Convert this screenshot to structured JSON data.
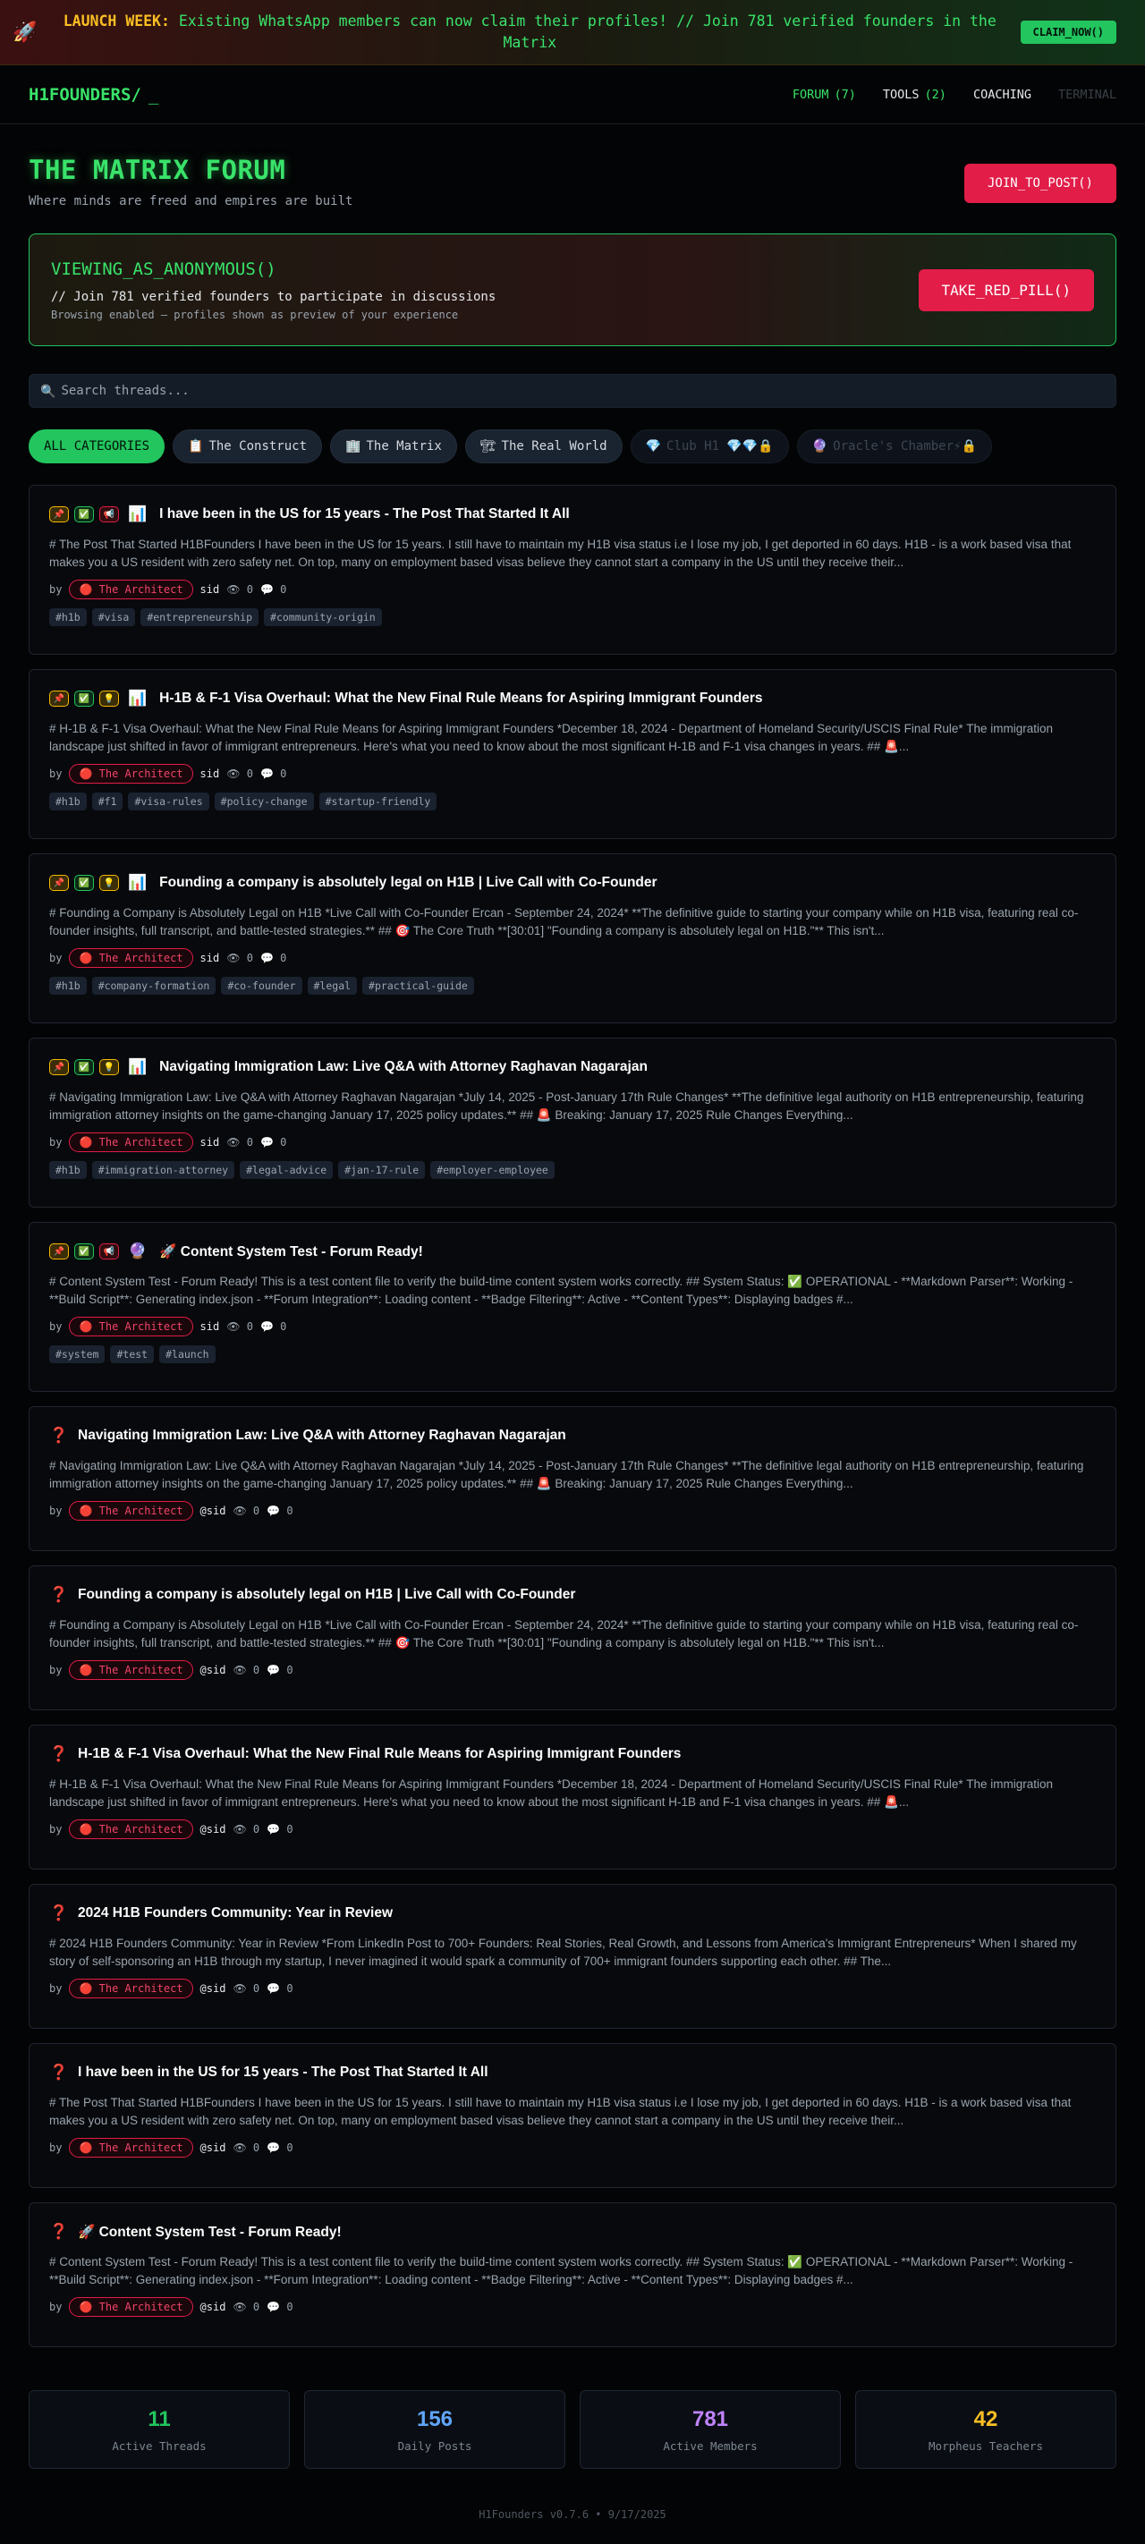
{
  "banner": {
    "icon": "rocket-icon",
    "lead": "LAUNCH WEEK:",
    "message": "Existing WhatsApp members can now claim their profiles! // Join 781 verified founders in the Matrix",
    "cta": "CLAIM_NOW()"
  },
  "nav": {
    "logo": "H1FOUNDERS/",
    "cursor": "_",
    "links": [
      {
        "label": "FORUM",
        "count": "(7)"
      },
      {
        "label": "TOOLS",
        "count": "(2)"
      },
      {
        "label": "COACHING",
        "count": ""
      },
      {
        "label": "TERMINAL",
        "count": ""
      }
    ]
  },
  "header": {
    "title": "THE MATRIX FORUM",
    "subtitle": "Where minds are freed and empires are built",
    "join": "JOIN_TO_POST()"
  },
  "anon": {
    "title": "VIEWING_AS_ANONYMOUS()",
    "line1": "// Join 781 verified founders to participate in discussions",
    "line2": "Browsing enabled — profiles shown as preview of your experience",
    "cta": "TAKE_RED_PILL()"
  },
  "search": {
    "placeholder": "Search threads..."
  },
  "categories": [
    {
      "label": "ALL CATEGORIES",
      "icon": ""
    },
    {
      "label": "The Construct",
      "icon": "📋"
    },
    {
      "label": "The Matrix",
      "icon": "🏢"
    },
    {
      "label": "The Real World",
      "icon": "🏗"
    },
    {
      "label": "Club H1 💎💎🔒",
      "icon": "💎"
    },
    {
      "label": "Oracle's Chamber⚡🔒",
      "icon": "🔮"
    }
  ],
  "threads": [
    {
      "title": "I have been in the US for 15 years - The Post That Started It All",
      "body": "# The Post That Started H1BFounders I have been in the US for 15 years. I still have to maintain my H1B visa status i.e I lose my job, I get deported in 60 days. H1B - is a work based visa that makes you a US resident with zero safety net. On top, many on employment based visas believe they cannot start a company in the US until they receive their...",
      "author": "The Architect",
      "handle": "sid",
      "views": "0",
      "comments": "0",
      "tags": [
        "#h1b",
        "#visa",
        "#entrepreneurship",
        "#community-origin"
      ]
    },
    {
      "title": "H-1B & F-1 Visa Overhaul: What the New Final Rule Means for Aspiring Immigrant Founders",
      "body": "# H-1B & F-1 Visa Overhaul: What the New Final Rule Means for Aspiring Immigrant Founders *December 18, 2024 - Department of Homeland Security/USCIS Final Rule* The immigration landscape just shifted in favor of immigrant entrepreneurs. Here's what you need to know about the most significant H-1B and F-1 visa changes in years. ## 🚨...",
      "author": "The Architect",
      "handle": "sid",
      "views": "0",
      "comments": "0",
      "tags": [
        "#h1b",
        "#f1",
        "#visa-rules",
        "#policy-change",
        "#startup-friendly"
      ]
    },
    {
      "title": "Founding a company is absolutely legal on H1B | Live Call with Co-Founder",
      "body": "# Founding a Company is Absolutely Legal on H1B *Live Call with Co-Founder Ercan - September 24, 2024* **The definitive guide to starting your company while on H1B visa, featuring real co-founder insights, full transcript, and battle-tested strategies.** ## 🎯 The Core Truth **[30:01] \"Founding a company is absolutely legal on H1B.\"** This isn't...",
      "author": "The Architect",
      "handle": "sid",
      "views": "0",
      "comments": "0",
      "tags": [
        "#h1b",
        "#company-formation",
        "#co-founder",
        "#legal",
        "#practical-guide"
      ]
    },
    {
      "title": "Navigating Immigration Law: Live Q&A with Attorney Raghavan Nagarajan",
      "body": "# Navigating Immigration Law: Live Q&A with Attorney Raghavan Nagarajan *July 14, 2025 - Post-January 17th Rule Changes* **The definitive legal authority on H1B entrepreneurship, featuring immigration attorney insights on the game-changing January 17, 2025 policy updates.** ## 🚨 Breaking: January 17, 2025 Rule Changes Everything...",
      "author": "The Architect",
      "handle": "sid",
      "views": "0",
      "comments": "0",
      "tags": [
        "#h1b",
        "#immigration-attorney",
        "#legal-advice",
        "#jan-17-rule",
        "#employer-employee"
      ]
    },
    {
      "title": "🚀 Content System Test - Forum Ready!",
      "body": "# Content System Test - Forum Ready! This is a test content file to verify the build-time content system works correctly. ## System Status: ✅ OPERATIONAL - **Markdown Parser**: Working - **Build Script**: Generating index.json - **Forum Integration**: Loading content - **Badge Filtering**: Active - **Content Types**: Displaying badges #...",
      "author": "The Architect",
      "handle": "sid",
      "views": "0",
      "comments": "0",
      "tags": [
        "#system",
        "#test",
        "#launch"
      ]
    },
    {
      "title": "Navigating Immigration Law: Live Q&A with Attorney Raghavan Nagarajan",
      "body": "# Navigating Immigration Law: Live Q&A with Attorney Raghavan Nagarajan *July 14, 2025 - Post-January 17th Rule Changes* **The definitive legal authority on H1B entrepreneurship, featuring immigration attorney insights on the game-changing January 17, 2025 policy updates.** ## 🚨 Breaking: January 17, 2025 Rule Changes Everything...",
      "author": "The Architect",
      "handle": "@sid",
      "views": "0",
      "comments": "0",
      "tags": []
    },
    {
      "title": "Founding a company is absolutely legal on H1B | Live Call with Co-Founder",
      "body": "# Founding a Company is Absolutely Legal on H1B *Live Call with Co-Founder Ercan - September 24, 2024* **The definitive guide to starting your company while on H1B visa, featuring real co-founder insights, full transcript, and battle-tested strategies.** ## 🎯 The Core Truth **[30:01] \"Founding a company is absolutely legal on H1B.\"** This isn't...",
      "author": "The Architect",
      "handle": "@sid",
      "views": "0",
      "comments": "0",
      "tags": []
    },
    {
      "title": "H-1B & F-1 Visa Overhaul: What the New Final Rule Means for Aspiring Immigrant Founders",
      "body": "# H-1B & F-1 Visa Overhaul: What the New Final Rule Means for Aspiring Immigrant Founders *December 18, 2024 - Department of Homeland Security/USCIS Final Rule* The immigration landscape just shifted in favor of immigrant entrepreneurs. Here's what you need to know about the most significant H-1B and F-1 visa changes in years. ## 🚨...",
      "author": "The Architect",
      "handle": "@sid",
      "views": "0",
      "comments": "0",
      "tags": []
    },
    {
      "title": "2024 H1B Founders Community: Year in Review",
      "body": "# 2024 H1B Founders Community: Year in Review *From LinkedIn Post to 700+ Founders: Real Stories, Real Growth, and Lessons from America's Immigrant Entrepreneurs* When I shared my story of self-sponsoring an H1B through my startup, I never imagined it would spark a community of 700+ immigrant founders supporting each other. ## The...",
      "author": "The Architect",
      "handle": "@sid",
      "views": "0",
      "comments": "0",
      "tags": []
    },
    {
      "title": "I have been in the US for 15 years - The Post That Started It All",
      "body": "# The Post That Started H1BFounders I have been in the US for 15 years. I still have to maintain my H1B visa status i.e I lose my job, I get deported in 60 days. H1B - is a work based visa that makes you a US resident with zero safety net. On top, many on employment based visas believe they cannot start a company in the US until they receive their...",
      "author": "The Architect",
      "handle": "@sid",
      "views": "0",
      "comments": "0",
      "tags": []
    },
    {
      "title": "🚀 Content System Test - Forum Ready!",
      "body": "# Content System Test - Forum Ready! This is a test content file to verify the build-time content system works correctly. ## System Status: ✅ OPERATIONAL - **Markdown Parser**: Working - **Build Script**: Generating index.json - **Forum Integration**: Loading content - **Badge Filtering**: Active - **Content Types**: Displaying badges #...",
      "author": "The Architect",
      "handle": "@sid",
      "views": "0",
      "comments": "0",
      "tags": []
    }
  ],
  "stats": [
    {
      "value": "11",
      "label": "Active Threads",
      "color": "#22c55e"
    },
    {
      "value": "156",
      "label": "Daily Posts",
      "color": "#60a5fa"
    },
    {
      "value": "781",
      "label": "Active Members",
      "color": "#c084fc"
    },
    {
      "value": "42",
      "label": "Morpheus Teachers",
      "color": "#fbbf24"
    }
  ],
  "footer": "H1Founders v0.7.6 • 9/17/2025"
}
